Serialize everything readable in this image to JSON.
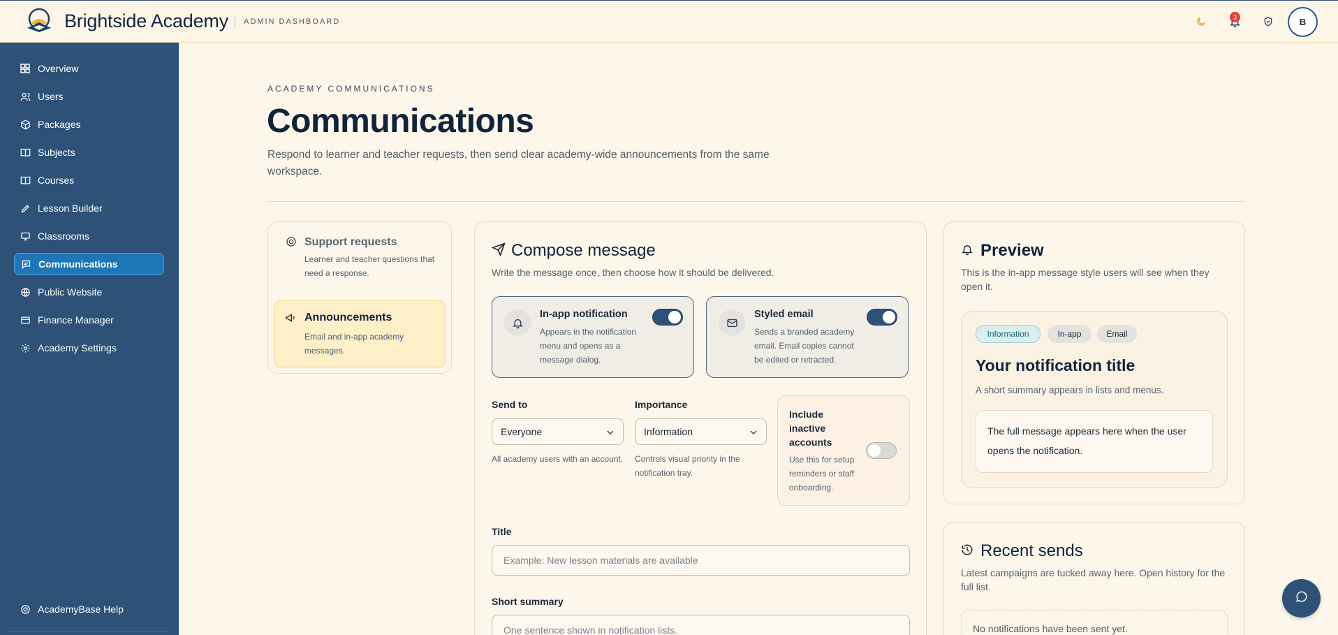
{
  "brand": {
    "name": "Brightside Academy",
    "subtitle": "ADMIN DASHBOARD"
  },
  "topbar": {
    "notification_count": "3",
    "avatar_initial": "B"
  },
  "sidebar": {
    "items": [
      {
        "label": "Overview",
        "icon": "grid-icon"
      },
      {
        "label": "Users",
        "icon": "users-icon"
      },
      {
        "label": "Packages",
        "icon": "package-icon"
      },
      {
        "label": "Subjects",
        "icon": "book-open-icon"
      },
      {
        "label": "Courses",
        "icon": "book-icon"
      },
      {
        "label": "Lesson Builder",
        "icon": "pencil-icon"
      },
      {
        "label": "Classrooms",
        "icon": "monitor-icon"
      },
      {
        "label": "Communications",
        "icon": "message-icon",
        "active": true
      },
      {
        "label": "Public Website",
        "icon": "globe-icon"
      },
      {
        "label": "Finance Manager",
        "icon": "wallet-icon"
      },
      {
        "label": "Academy Settings",
        "icon": "gear-icon"
      }
    ],
    "help_label": "AcademyBase Help"
  },
  "header": {
    "eyebrow": "ACADEMY COMMUNICATIONS",
    "title": "Communications",
    "description": "Respond to learner and teacher requests, then send clear academy-wide announcements from the same workspace."
  },
  "tabs": [
    {
      "title": "Support requests",
      "description": "Learner and teacher questions that need a response."
    },
    {
      "title": "Announcements",
      "description": "Email and in-app academy messages.",
      "active": true
    }
  ],
  "compose": {
    "title": "Compose message",
    "description": "Write the message once, then choose how it should be delivered.",
    "channels": [
      {
        "title": "In-app notification",
        "description": "Appears in the notification menu and opens as a message dialog.",
        "enabled": true
      },
      {
        "title": "Styled email",
        "description": "Sends a branded academy email. Email copies cannot be edited or retracted.",
        "enabled": true
      }
    ],
    "send_to": {
      "label": "Send to",
      "value": "Everyone",
      "help": "All academy users with an account."
    },
    "importance": {
      "label": "Importance",
      "value": "Information",
      "help": "Controls visual priority in the notification tray."
    },
    "inactive": {
      "label": "Include inactive accounts",
      "help": "Use this for setup reminders or staff onboarding.",
      "enabled": false
    },
    "title_field": {
      "label": "Title",
      "placeholder": "Example: New lesson materials are available"
    },
    "summary_field": {
      "label": "Short summary",
      "placeholder": "One sentence shown in notification lists."
    }
  },
  "preview": {
    "title": "Preview",
    "description": "This is the in-app message style users will see when they open it.",
    "chips": [
      "Information",
      "In-app",
      "Email"
    ],
    "notif_title": "Your notification title",
    "notif_summary": "A short summary appears in lists and menus.",
    "notif_body": "The full message appears here when the user opens the notification."
  },
  "recent": {
    "title": "Recent sends",
    "description": "Latest campaigns are tucked away here. Open history for the full list.",
    "empty": "No notifications have been sent yet."
  },
  "colors": {
    "sidebar_bg": "#2d5177",
    "active_nav": "#1d76b8",
    "page_bg": "#fdf6ea",
    "accent_tab": "#fdefc8"
  }
}
